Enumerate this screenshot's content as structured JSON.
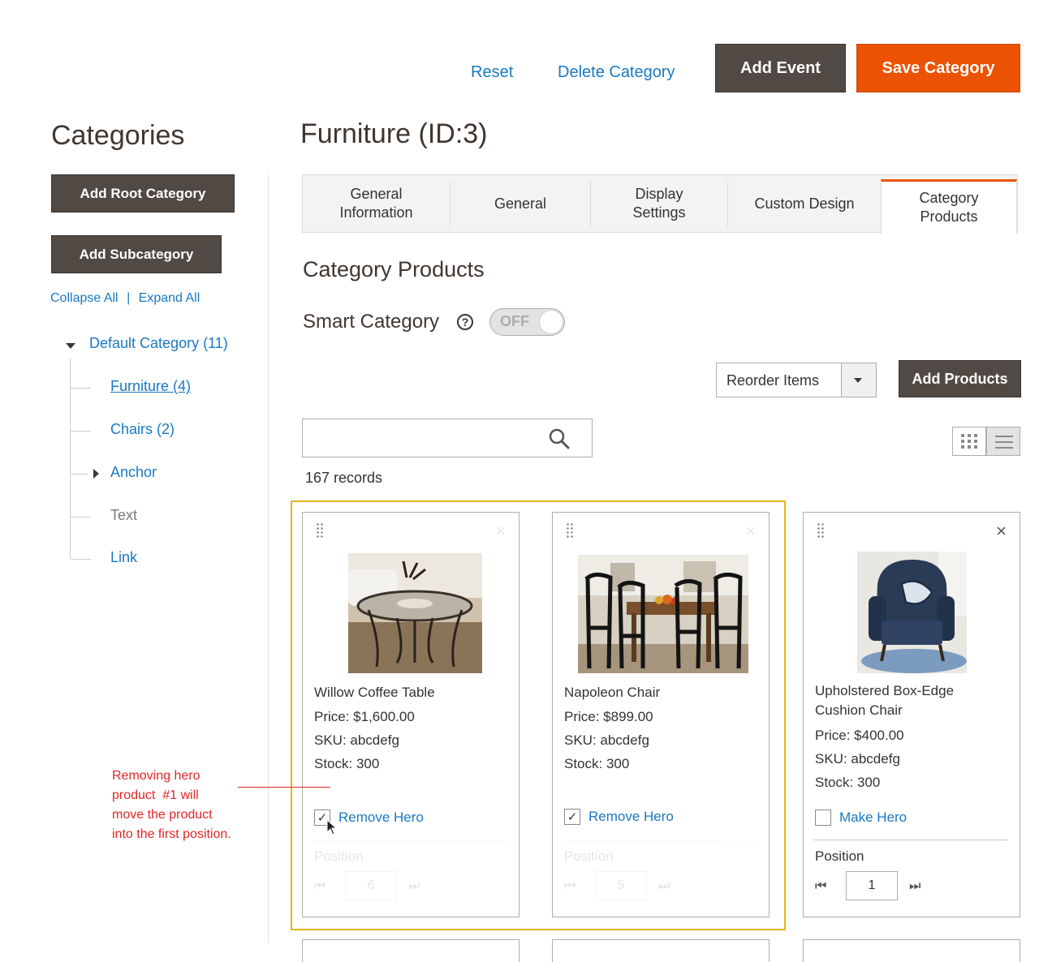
{
  "header": {
    "reset_label": "Reset",
    "delete_label": "Delete Category",
    "add_event_label": "Add Event",
    "save_label": "Save Category"
  },
  "sidebar": {
    "title": "Categories",
    "add_root_label": "Add Root Category",
    "add_sub_label": "Add Subcategory",
    "collapse_label": "Collapse All",
    "separator": "|",
    "expand_label": "Expand All",
    "tree": {
      "root": "Default Category (11)",
      "items": [
        "Furniture (4)",
        "Chairs (2)",
        "Anchor",
        "Text",
        "Link"
      ]
    }
  },
  "main": {
    "page_title": "Furniture (ID:3)",
    "tabs": [
      {
        "label_line1": "General",
        "label_line2": "Information"
      },
      {
        "label_line1": "General",
        "label_line2": ""
      },
      {
        "label_line1": "Display",
        "label_line2": "Settings"
      },
      {
        "label_line1": "Custom Design",
        "label_line2": ""
      },
      {
        "label_line1": "Category",
        "label_line2": "Products"
      }
    ],
    "section_title": "Category Products",
    "smart_category_label": "Smart Category",
    "help_icon_glyph": "?",
    "toggle_label": "OFF",
    "reorder_label": "Reorder Items",
    "add_products_label": "Add Products",
    "search_placeholder": "",
    "records": "167 records"
  },
  "products": [
    {
      "name": "Willow Coffee Table",
      "price": "Price: $1,600.00",
      "sku": "SKU: abcdefg",
      "stock": "Stock: 300",
      "hero_label": "Remove Hero",
      "hero_checked": "✓",
      "position_label": "Position",
      "position": "6"
    },
    {
      "name": "Napoleon Chair",
      "price": "Price: $899.00",
      "sku": "SKU: abcdefg",
      "stock": "Stock: 300",
      "hero_label": "Remove Hero",
      "hero_checked": "✓",
      "position_label": "Position",
      "position": "5"
    },
    {
      "name_line1": "Upholstered Box-Edge",
      "name_line2": "Cushion Chair",
      "price": "Price: $400.00",
      "sku": "SKU: abcdefg",
      "stock": "Stock: 300",
      "hero_label": "Make Hero",
      "position_label": "Position",
      "position": "1"
    }
  ],
  "annotation": {
    "line1": "Removing hero",
    "line2": "product  #1 will",
    "line3": "move the product",
    "line4": "into the first position."
  },
  "icons": {
    "close": "×",
    "first": "⏮",
    "last": "⏭"
  },
  "colors": {
    "accent_orange": "#eb5202",
    "dark_button": "#514943",
    "link_blue": "#1979c3",
    "highlight_frame": "#e2b619",
    "annotation_red": "#e22626"
  }
}
